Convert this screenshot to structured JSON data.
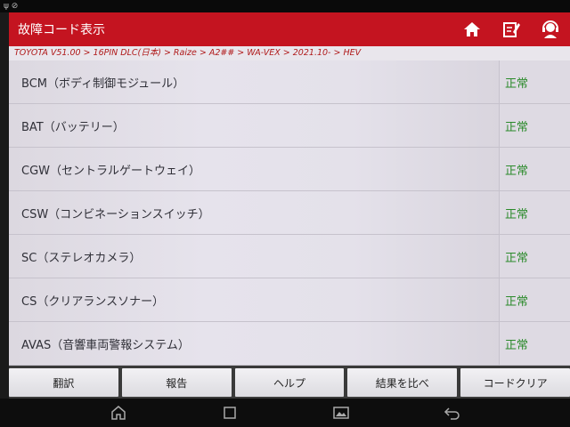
{
  "app": {
    "title": "故障コード表示"
  },
  "breadcrumb": "TOYOTA V51.00 > 16PIN DLC(日本) > Raize > A2## > WA-VEX > 2021.10- > HEV",
  "systems": [
    {
      "name": "BCM（ボディ制御モジュール）",
      "status": "正常"
    },
    {
      "name": "BAT（バッテリー）",
      "status": "正常"
    },
    {
      "name": "CGW（セントラルゲートウェイ）",
      "status": "正常"
    },
    {
      "name": "CSW（コンビネーションスイッチ）",
      "status": "正常"
    },
    {
      "name": "SC（ステレオカメラ）",
      "status": "正常"
    },
    {
      "name": "CS（クリアランスソナー）",
      "status": "正常"
    },
    {
      "name": "AVAS（音響車両警報システム）",
      "status": "正常"
    }
  ],
  "toolbar": {
    "translate_label": "翻訳",
    "report_label": "報告",
    "help_label": "ヘルプ",
    "compare_label": "結果を比べ",
    "clear_label": "コードクリア"
  },
  "icons": {
    "home": "home-icon",
    "edit": "edit-icon",
    "support": "support-icon",
    "nav_home": "nav-home-icon",
    "nav_recent": "nav-recent-icon",
    "nav_screenshot": "nav-screenshot-icon",
    "nav_back": "nav-back-icon"
  },
  "colors": {
    "appbar": "#c41420",
    "status_ok": "#2b8a2b",
    "breadcrumb_text": "#b01a1a"
  }
}
